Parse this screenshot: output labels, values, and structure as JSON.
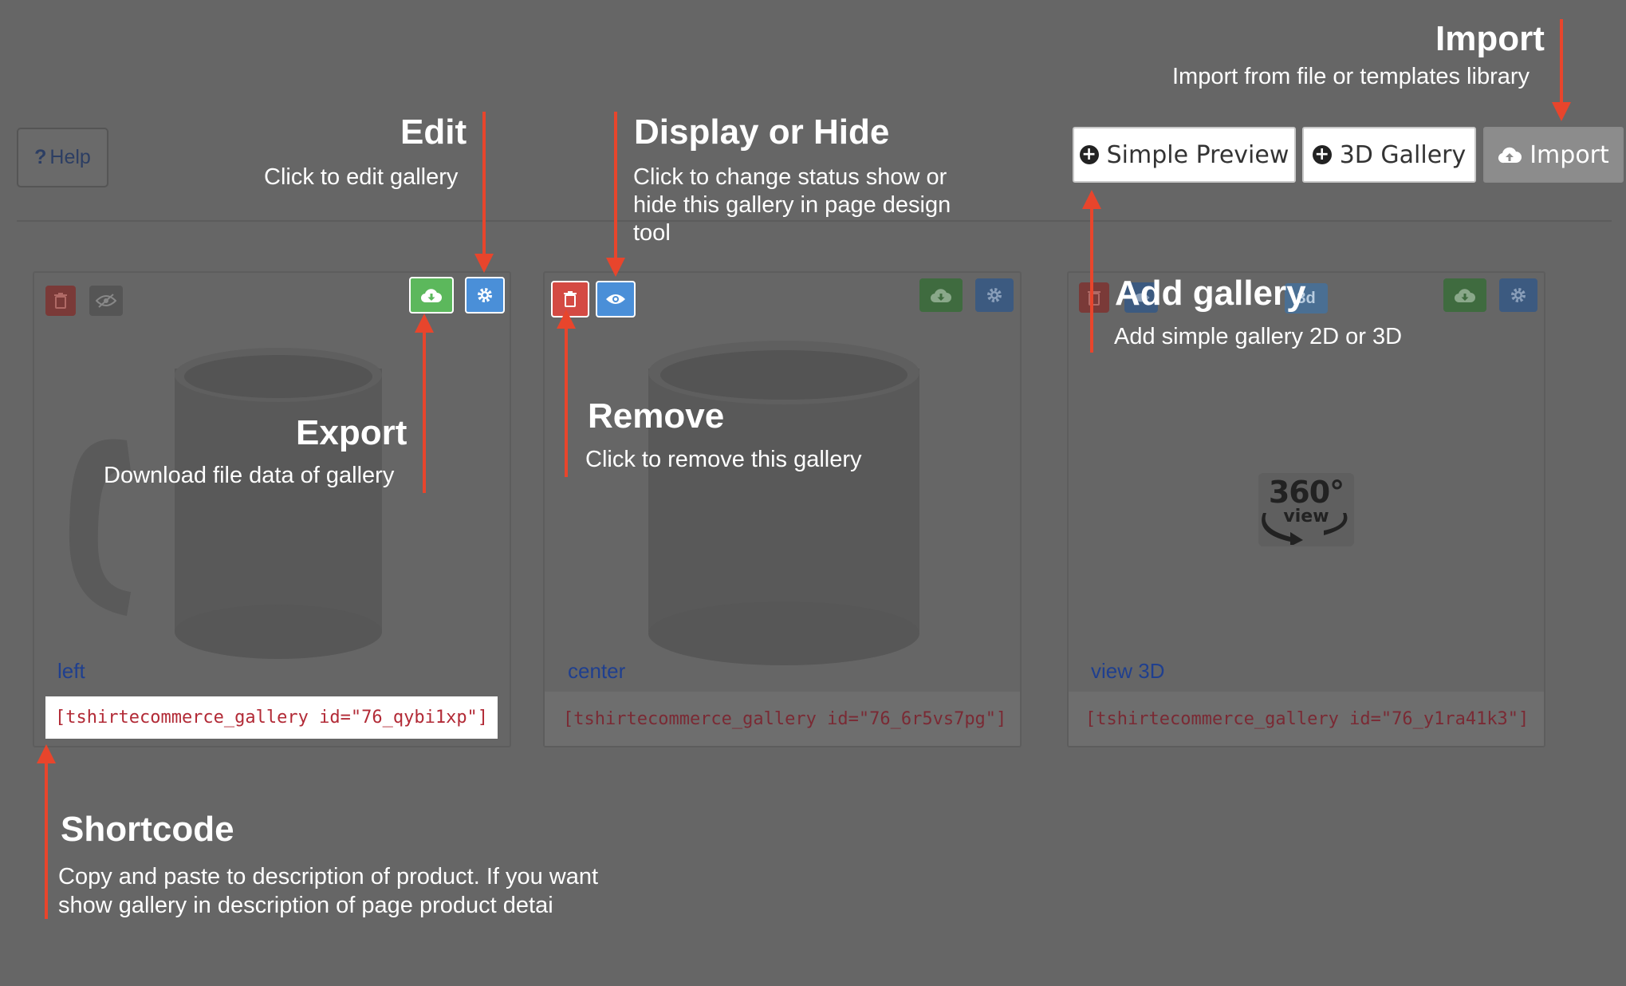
{
  "help_button": {
    "label": "Help",
    "icon": "question-icon"
  },
  "toolbar": {
    "simple_preview": "Simple Preview",
    "gallery_3d": "3D Gallery",
    "import": "Import"
  },
  "cards": [
    {
      "label": "left",
      "shortcode": "[tshirtecommerce_gallery id=\"76_qybi1xp\"]"
    },
    {
      "label": "center",
      "shortcode": "[tshirtecommerce_gallery id=\"76_6r5vs7pg\"]"
    },
    {
      "label": "view 3D",
      "shortcode": "[tshirtecommerce_gallery id=\"76_y1ra41k3\"]",
      "badge": "3d",
      "image_text": "360°",
      "image_sub": "view"
    }
  ],
  "annotations": {
    "import": {
      "title": "Import",
      "text": "Import from file or templates library"
    },
    "edit": {
      "title": "Edit",
      "text": "Click to edit gallery"
    },
    "display": {
      "title": "Display or Hide",
      "line1": "Click to change status show or",
      "line2": "hide this gallery in page design",
      "line3": "tool"
    },
    "add": {
      "title": "Add gallery",
      "text": "Add simple gallery 2D or 3D"
    },
    "export": {
      "title": "Export",
      "text": "Download file data of gallery"
    },
    "remove": {
      "title": "Remove",
      "text": "Click to remove this gallery"
    },
    "shortcode": {
      "title": "Shortcode",
      "line1": "Copy and paste to description of product. If you want",
      "line2": "show gallery in description of page product detai"
    }
  },
  "colors": {
    "arrow": "#e8452c",
    "delete": "#d44a43",
    "export": "#5cb85c",
    "edit": "#4a8fd8",
    "overlay": "#666666"
  }
}
